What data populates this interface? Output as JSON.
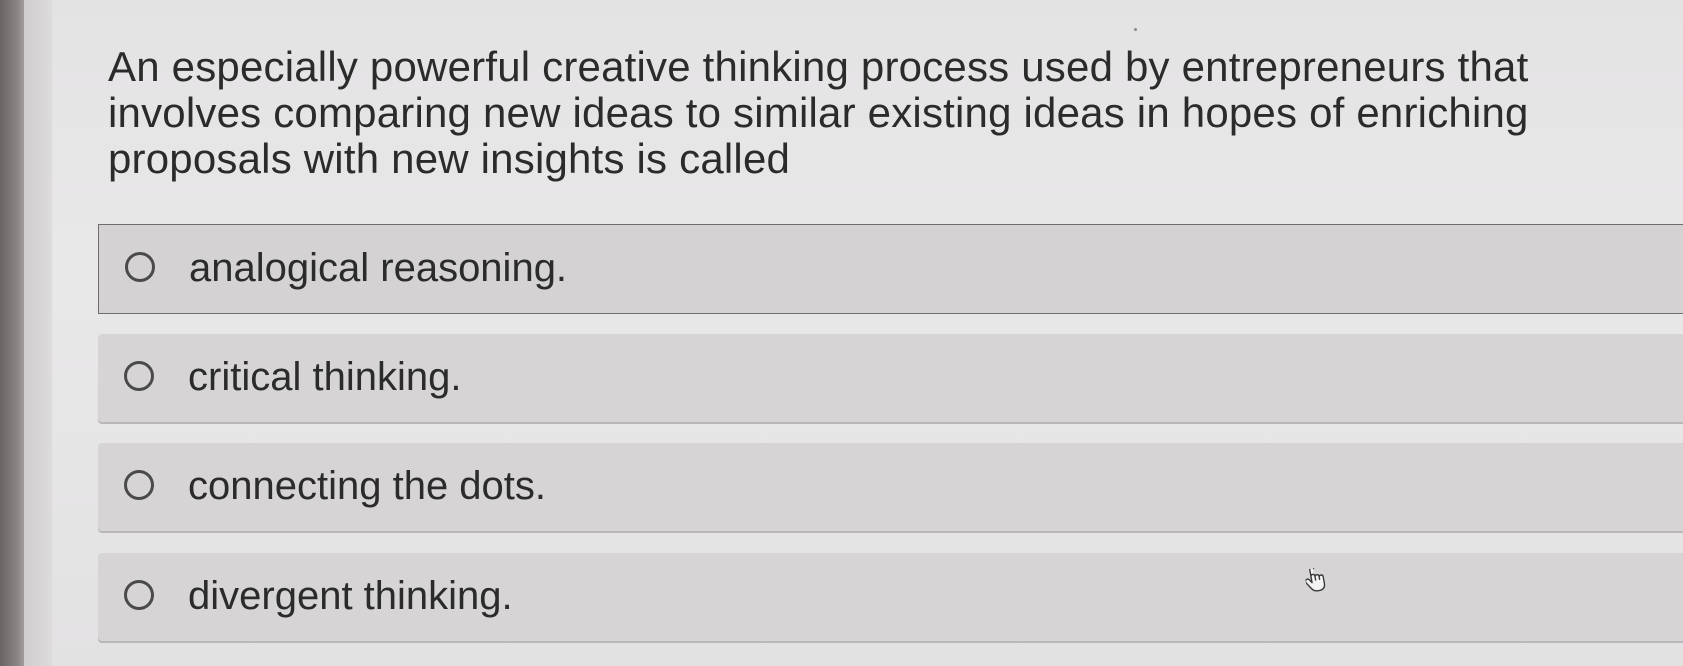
{
  "question": {
    "text": "An especially powerful creative thinking process used by entrepreneurs that involves comparing new ideas to similar existing ideas in hopes of enriching proposals with new insights is called"
  },
  "options": [
    {
      "label": "analogical reasoning.",
      "selected": false
    },
    {
      "label": "critical thinking.",
      "selected": false
    },
    {
      "label": "connecting the dots.",
      "selected": false
    },
    {
      "label": "divergent thinking.",
      "selected": false
    }
  ],
  "cursor": {
    "icon": "hand-pointer-icon"
  }
}
